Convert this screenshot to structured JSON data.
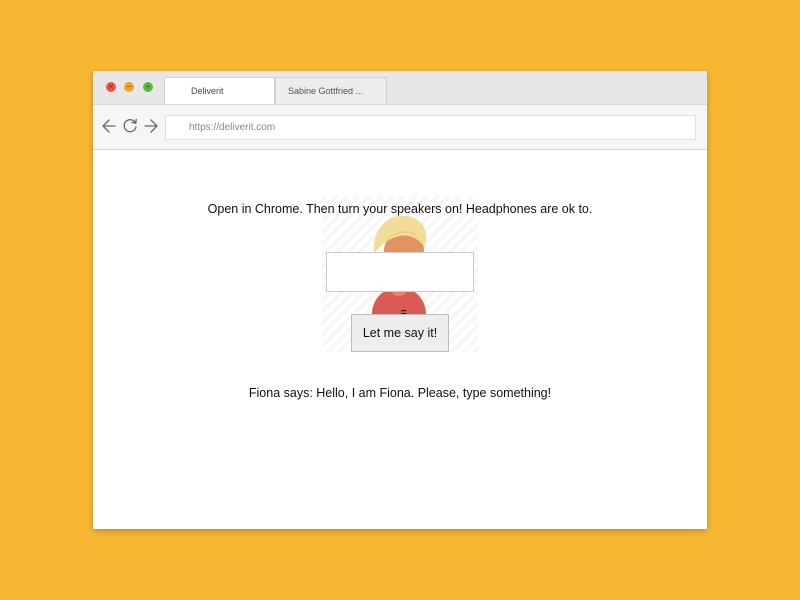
{
  "colors": {
    "background": "#F8B832",
    "window_close": "#E8574A",
    "window_minimize": "#F0A522",
    "window_maximize": "#56BE3C",
    "avatar_hair": "#F2DC9A",
    "avatar_skin": "#E29460",
    "avatar_red": "#DC5A55"
  },
  "window": {
    "controls": {
      "close_icon": "×",
      "minimize_icon": "−",
      "maximize_icon": "+"
    },
    "tabs": [
      {
        "label": "Deliverit",
        "active": true
      },
      {
        "label": "Sabine Gottfried ...",
        "active": false
      }
    ]
  },
  "toolbar": {
    "back_icon": "back-arrow-icon",
    "reload_icon": "reload-icon",
    "forward_icon": "forward-arrow-icon",
    "url": "https://deliverit.com"
  },
  "page": {
    "instruction": "Open in Chrome. Then turn your speakers on! Headphones are ok to.",
    "input_value": "",
    "button_label": "Let me say it!",
    "speech": "Fiona says: Hello, I am Fiona. Please, type something!"
  }
}
